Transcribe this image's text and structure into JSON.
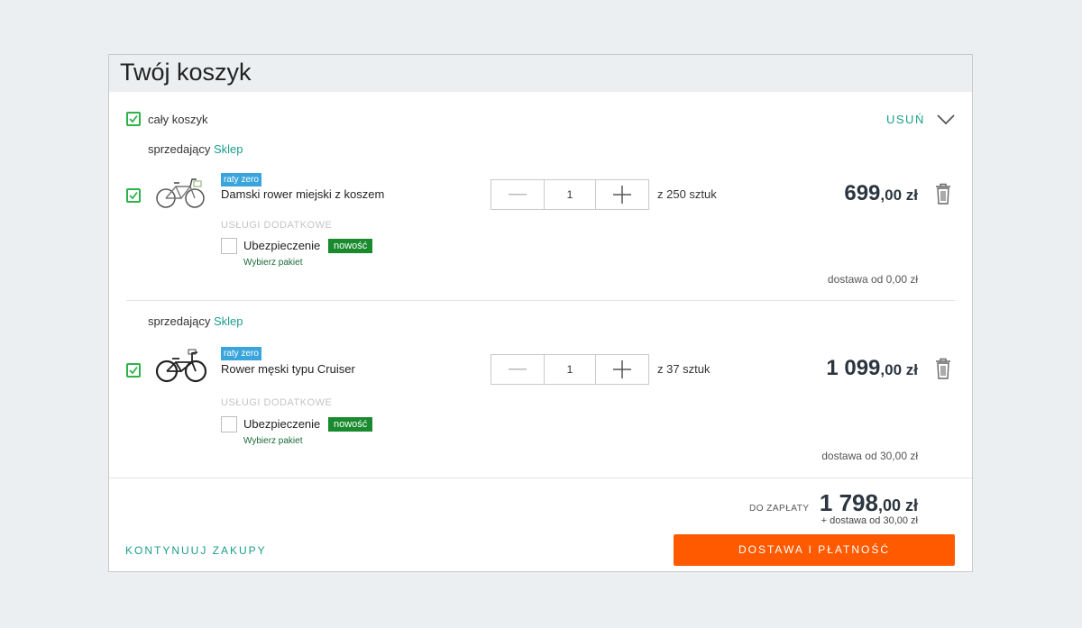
{
  "cart": {
    "title": "Twój koszyk",
    "select_all_label": "cały koszyk",
    "remove_label": "USUŃ",
    "seller_prefix": "sprzedający",
    "seller_name": "Sklep"
  },
  "items": [
    {
      "badge": "raty zero",
      "name": "Damski rower miejski z koszem",
      "services_header": "USŁUGI DODATKOWE",
      "insurance_label": "Ubezpieczenie",
      "new_badge": "nowość",
      "pick_package": "Wybierz pakiet",
      "quantity": "1",
      "stock": "z 250 sztuk",
      "price_int": "699",
      "price_dec": ",00 zł",
      "delivery": "dostawa od 0,00 zł"
    },
    {
      "badge": "raty zero",
      "name": "Rower męski typu Cruiser",
      "services_header": "USŁUGI DODATKOWE",
      "insurance_label": "Ubezpieczenie",
      "new_badge": "nowość",
      "pick_package": "Wybierz pakiet",
      "quantity": "1",
      "stock": "z 37 sztuk",
      "price_int": "1 099",
      "price_dec": ",00 zł",
      "delivery": "dostawa od 30,00 zł"
    }
  ],
  "summary": {
    "to_pay_label": "DO ZAPŁATY",
    "total_int": "1 798",
    "total_dec": ",00 zł",
    "delivery_note": "+ dostawa od 30,00 zł",
    "continue_label": "KONTYNUUJ ZAKUPY",
    "checkout_label": "DOSTAWA I PŁATNOŚĆ"
  },
  "colors": {
    "accent": "#1b9d8c",
    "checkbox_green": "#2db34a",
    "checkout_orange": "#ff5a00",
    "new_badge": "#1a8a2e",
    "raty_badge": "#3aa5dc"
  },
  "icons": [
    "check-icon",
    "chevron-down-icon",
    "minus-icon",
    "plus-icon",
    "trash-icon",
    "bicycle-image"
  ]
}
